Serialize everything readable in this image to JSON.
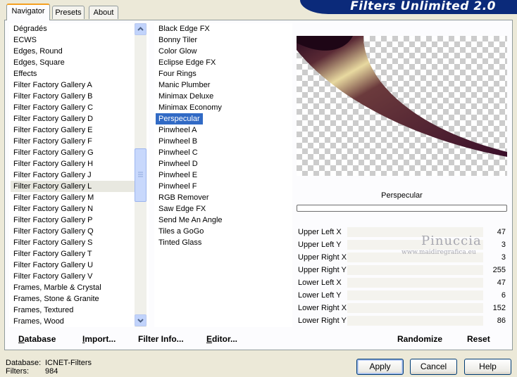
{
  "tabs": [
    "Navigator",
    "Presets",
    "About"
  ],
  "banner_title": "Filters Unlimited 2.0",
  "categories": [
    "Dégradés",
    "ECWS",
    "Edges, Round",
    "Edges, Square",
    "Effects",
    "Filter Factory Gallery A",
    "Filter Factory Gallery B",
    "Filter Factory Gallery C",
    "Filter Factory Gallery D",
    "Filter Factory Gallery E",
    "Filter Factory Gallery F",
    "Filter Factory Gallery G",
    "Filter Factory Gallery H",
    "Filter Factory Gallery J",
    "Filter Factory Gallery L",
    "Filter Factory Gallery M",
    "Filter Factory Gallery N",
    "Filter Factory Gallery P",
    "Filter Factory Gallery Q",
    "Filter Factory Gallery S",
    "Filter Factory Gallery T",
    "Filter Factory Gallery U",
    "Filter Factory Gallery V",
    "Frames, Marble & Crystal",
    "Frames, Stone & Granite",
    "Frames, Textured",
    "Frames, Wood"
  ],
  "selected_category": "Filter Factory Gallery L",
  "filters": [
    "Black Edge FX",
    "Bonny Tiler",
    "Color Glow",
    "Eclipse Edge FX",
    "Four Rings",
    "Manic Plumber",
    "Minimax Deluxe",
    "Minimax Economy",
    "Perspecular",
    "Pinwheel A",
    "Pinwheel B",
    "Pinwheel C",
    "Pinwheel D",
    "Pinwheel E",
    "Pinwheel F",
    "RGB Remover",
    "Saw Edge FX",
    "Send Me An Angle",
    "Tiles a GoGo",
    "Tinted Glass"
  ],
  "selected_filter": "Perspecular",
  "preview_filter_name": "Perspecular",
  "parameters": [
    {
      "label": "Upper Left X",
      "value": "47"
    },
    {
      "label": "Upper Left Y",
      "value": "3"
    },
    {
      "label": "Upper Right X",
      "value": "3"
    },
    {
      "label": "Upper Right Y",
      "value": "255"
    },
    {
      "label": "Lower Left X",
      "value": "47"
    },
    {
      "label": "Lower Left Y",
      "value": "6"
    },
    {
      "label": "Lower Right X",
      "value": "152"
    },
    {
      "label": "Lower Right Y",
      "value": "86"
    }
  ],
  "watermark": {
    "name": "Pinuccia",
    "url": "www.maidiregrafica.eu"
  },
  "bottom_bar": {
    "database": "Database",
    "import": "Import...",
    "filter_info": "Filter Info...",
    "editor": "Editor...",
    "randomize": "Randomize",
    "reset": "Reset"
  },
  "status": {
    "database_label": "Database:",
    "database_value": "ICNET-Filters",
    "filters_label": "Filters:",
    "filters_value": "984"
  },
  "buttons": {
    "apply": "Apply",
    "cancel": "Cancel",
    "help": "Help"
  },
  "colors": {
    "banner": "#0b2a7a",
    "selection": "#316ac5",
    "swoosh_dark": "#3a0f2a",
    "swoosh_light": "#e8d9a0"
  }
}
